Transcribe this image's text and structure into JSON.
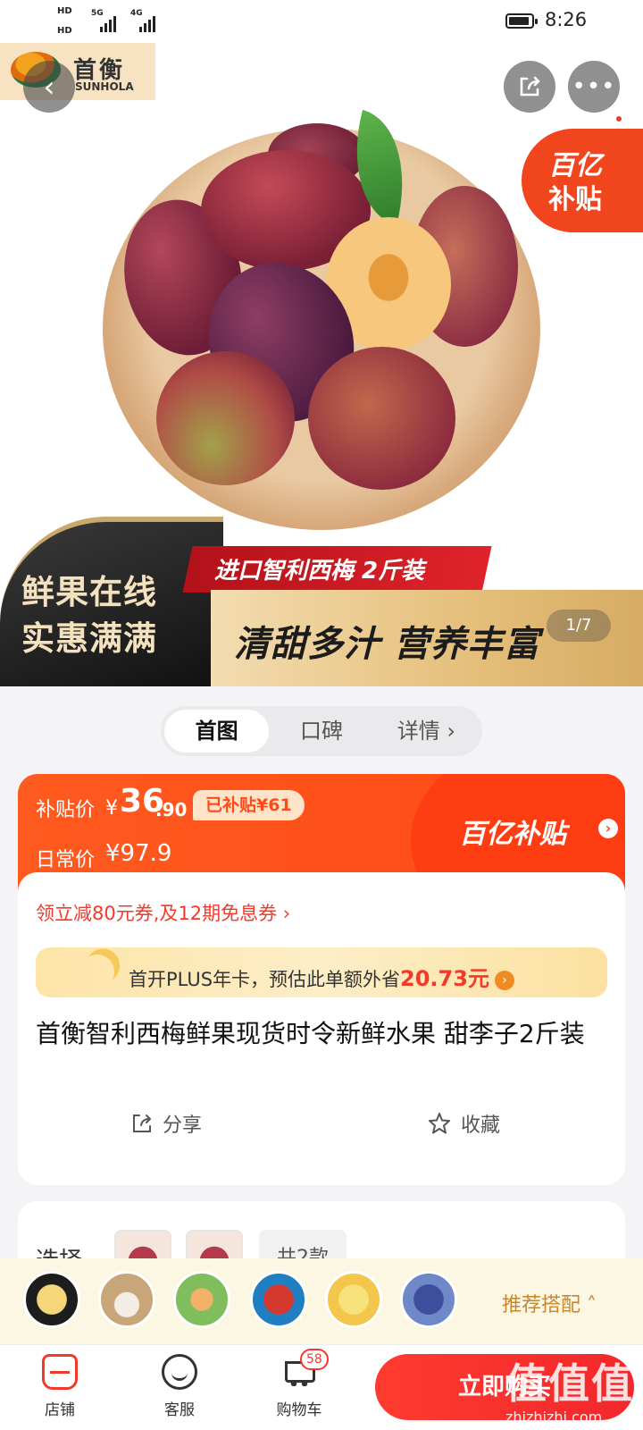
{
  "status_bar": {
    "hd1": "HD",
    "hd2": "HD",
    "sig1_label": "5G",
    "sig2_label": "4G",
    "time": "8:26"
  },
  "logo": {
    "cn": "首衡",
    "en": "SUNHOLA"
  },
  "hero": {
    "subsidy_badge_line1": "百亿",
    "subsidy_badge_line2": "补贴",
    "left_line1": "鲜果在线",
    "left_line2": "实惠满满",
    "red_banner": "进口智利西梅 2斤装",
    "gold_banner": "清甜多汁 营养丰富",
    "image_counter": "1/7"
  },
  "tabs": [
    "首图",
    "口碑",
    "详情 ›"
  ],
  "price": {
    "subsidy_label": "补贴价",
    "currency": "¥",
    "integer": "36",
    "decimal": ".90",
    "saved_badge": "已补贴¥61",
    "regular_label": "日常价",
    "regular_price": "¥97.9",
    "brand_label": "百亿补贴",
    "brand_arrow": "›"
  },
  "coupon_text": "领立减80元券,及12期免息券 ›",
  "plus": {
    "text": "首开PLUS年卡，预估此单额外省",
    "amount": "20.73元",
    "arrow": "›"
  },
  "product_title": "首衡智利西梅鲜果现货时令新鲜水果 甜李子2斤装",
  "actions": {
    "share": "分享",
    "favorite": "收藏"
  },
  "select": {
    "label": "选择",
    "more": "共2款"
  },
  "recommend": {
    "label": "推荐搭配 ˄"
  },
  "bottom_bar": {
    "store": "店铺",
    "service": "客服",
    "cart": "购物车",
    "cart_count": "58",
    "buy": "立即购买"
  },
  "watermark": {
    "main": "值值值",
    "sub": "zhizhizhi.com"
  },
  "colors": {
    "accent_red": "#f23a2a",
    "subsidy_orange": "#ff4a16",
    "gold": "#e5bf7b"
  }
}
